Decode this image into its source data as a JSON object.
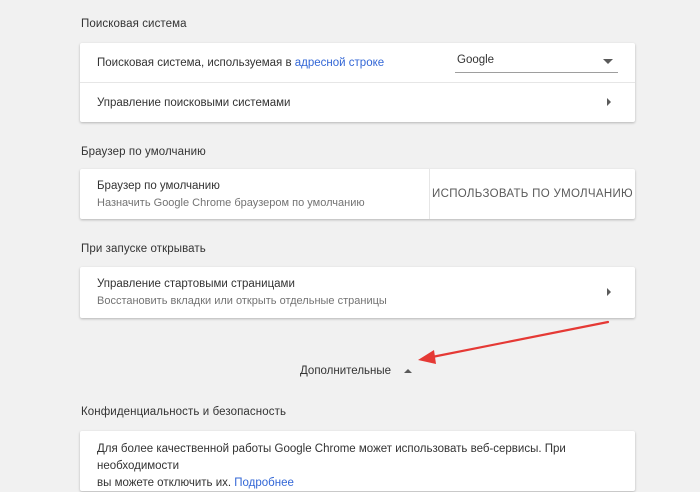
{
  "search_engine": {
    "section_title": "Поисковая система",
    "used_label_prefix": "Поисковая система, используемая в ",
    "used_label_link": "адресной строке",
    "selected_engine": "Google",
    "manage_label": "Управление поисковыми системами"
  },
  "default_browser": {
    "section_title": "Браузер по умолчанию",
    "primary": "Браузер по умолчанию",
    "secondary": "Назначить Google Chrome браузером по умолчанию",
    "button_label": "ИСПОЛЬЗОВАТЬ ПО УМОЛЧАНИЮ"
  },
  "on_startup": {
    "section_title": "При запуске открывать",
    "primary": "Управление стартовыми страницами",
    "secondary": "Восстановить вкладки или открыть отдельные страницы"
  },
  "advanced": {
    "label": "Дополнительные"
  },
  "privacy": {
    "section_title": "Конфиденциальность и безопасность",
    "text_line1": "Для более качественной работы Google Chrome может использовать веб-сервисы. При необходимости",
    "text_line2_prefix": "вы можете отключить их. ",
    "link": "Подробнее"
  },
  "annotation": {
    "arrow_color": "#e53935",
    "icon": "red-arrow-icon"
  },
  "colors": {
    "background": "#f1f1f1",
    "card": "#ffffff",
    "link": "#3367d6"
  }
}
